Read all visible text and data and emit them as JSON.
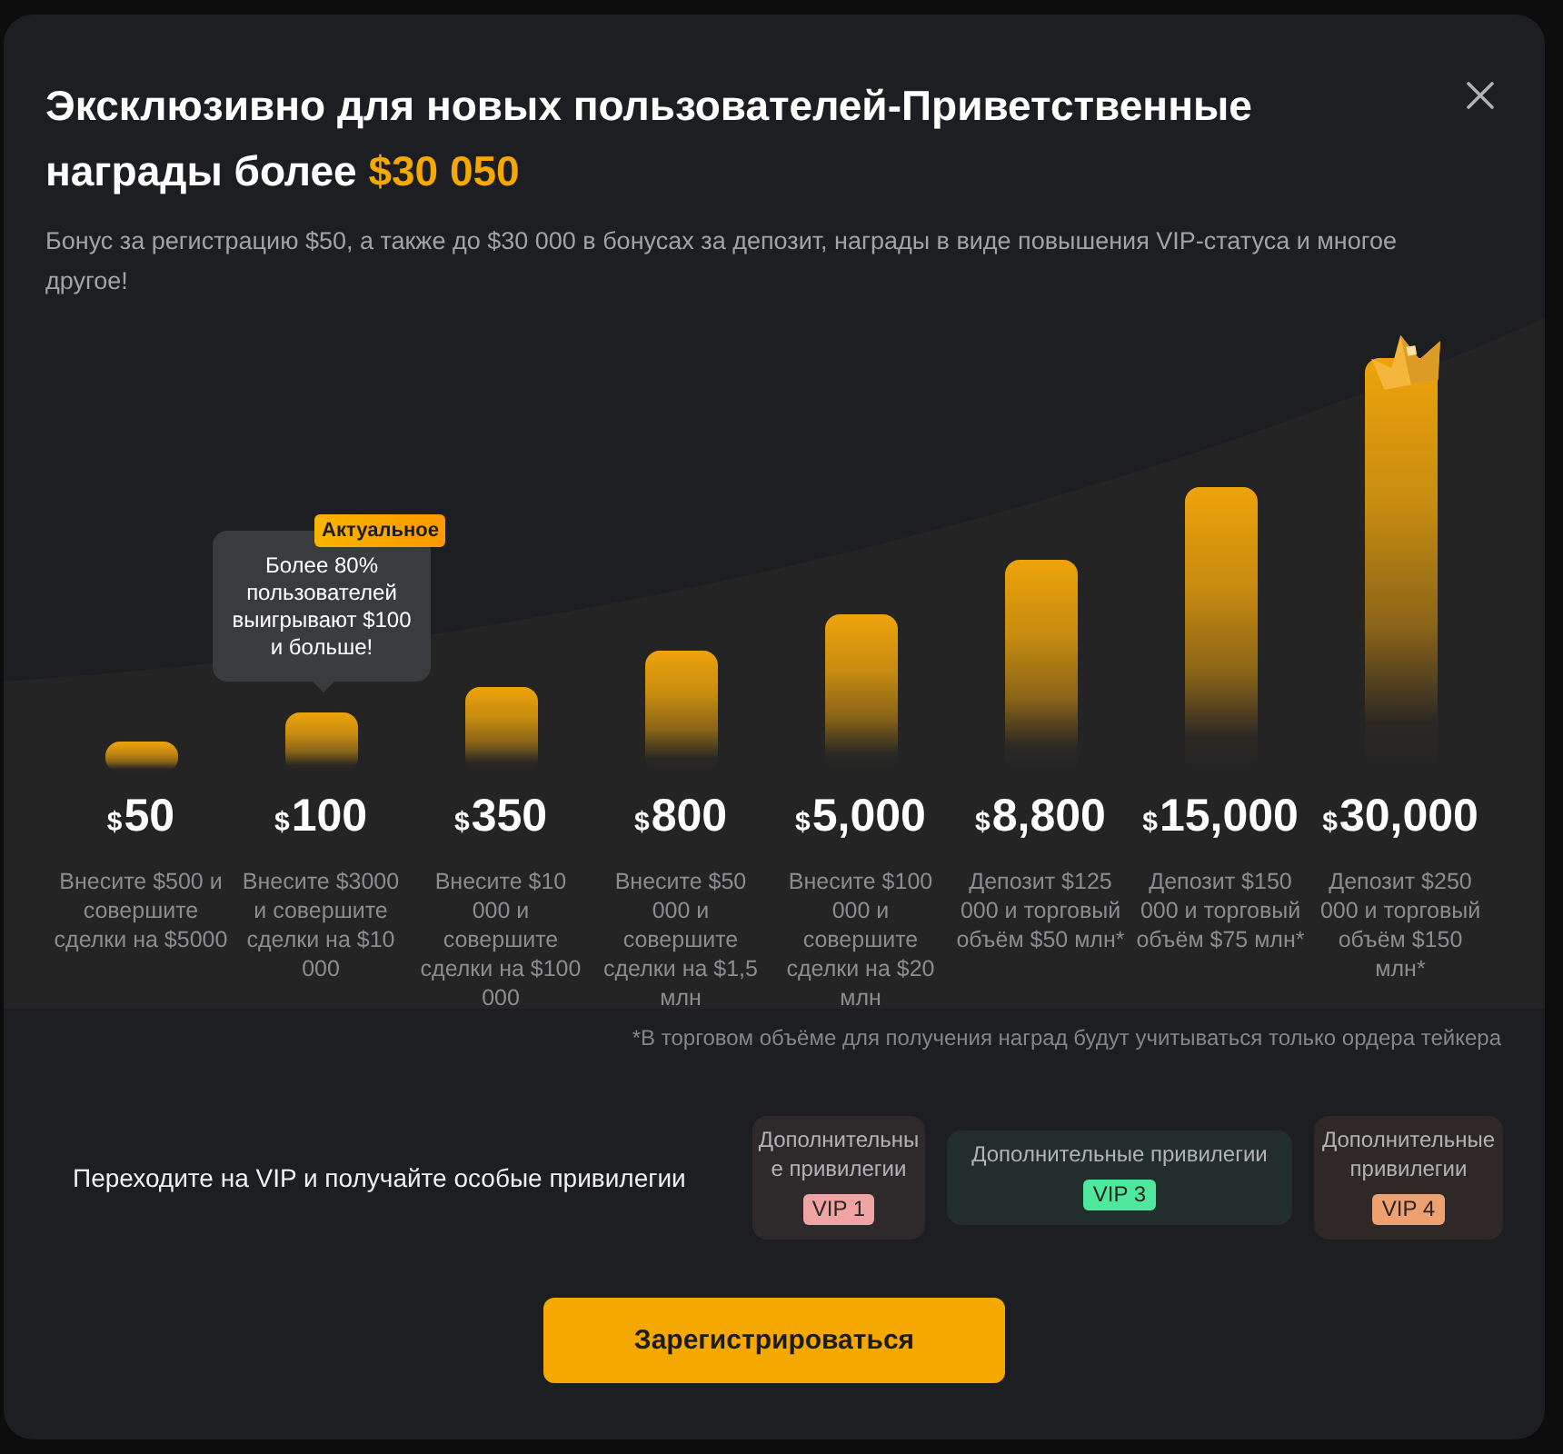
{
  "dialog": {
    "title": "Эксклюзивно для новых пользователей-Приветственные награды более",
    "title_highlight": "$30 050",
    "subtitle": "Бонус за регистрацию $50, а также до $30 000 в бонусах за депозит, награды в виде повышения VIP-статуса и многое другое!"
  },
  "tiers": [
    {
      "currency": "$",
      "amount": "50",
      "condition": "Внесите $500 и совершите сделки на $5000",
      "crown": false
    },
    {
      "currency": "$",
      "amount": "100",
      "condition": "Внесите $3000 и совершите сделки на $10 000",
      "crown": false,
      "tooltip": {
        "badge": "Актуальное",
        "text": "Более 80% пользователей выигрывают $100 и больше!"
      }
    },
    {
      "currency": "$",
      "amount": "350",
      "condition": "Внесите $10 000 и совершите сделки на $100 000",
      "crown": false
    },
    {
      "currency": "$",
      "amount": "800",
      "condition": "Внесите $50 000 и совершите сделки на $1,5 млн",
      "crown": false
    },
    {
      "currency": "$",
      "amount": "5,000",
      "condition": "Внесите $100 000 и совершите сделки на $20 млн",
      "crown": false
    },
    {
      "currency": "$",
      "amount": "8,800",
      "condition": "Депозит $125 000 и торговый объём $50 млн*",
      "crown": false
    },
    {
      "currency": "$",
      "amount": "15,000",
      "condition": "Депозит $150 000 и торговый объём $75 млн*",
      "crown": false
    },
    {
      "currency": "$",
      "amount": "30,000",
      "condition": "Депозит $250 000 и торговый объём $150 млн*",
      "crown": true
    }
  ],
  "footnote": "*В торговом объёме для получения наград будут учитываться только ордера тейкера",
  "vip": {
    "text": "Переходите на VIP и получайте особые привилегии",
    "cards": [
      {
        "text": "Дополнительные привилегии",
        "tag": "VIP 1",
        "color": "#f0a3a3"
      },
      {
        "text": "Дополнительные привилегии",
        "tag": "VIP 3",
        "color": "#4ee89c"
      },
      {
        "text": "Дополнительные привилегии",
        "tag": "VIP 4",
        "color": "#eda070"
      }
    ]
  },
  "register_button": {
    "label": "Зарегистрироваться"
  }
}
